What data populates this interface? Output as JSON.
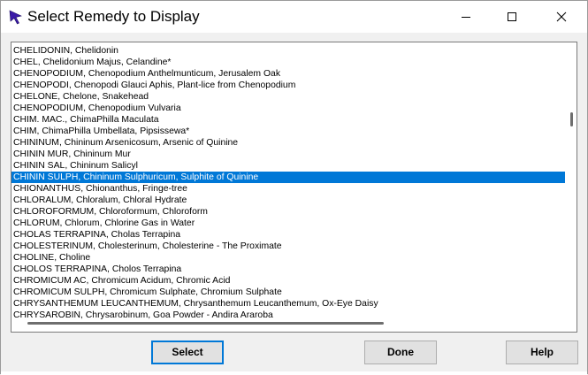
{
  "window": {
    "title": "Select Remedy to Display"
  },
  "titlebar_buttons": {
    "minimize_icon": "minimize-icon",
    "maximize_icon": "maximize-icon",
    "close_icon": "close-icon"
  },
  "list": {
    "items": [
      "CHELIDONIN, Chelidonin",
      "CHEL, Chelidonium Majus, Celandine*",
      "CHENOPODIUM, Chenopodium Anthelmunticum, Jerusalem Oak",
      "CHENOPODI, Chenopodi Glauci Aphis, Plant-lice from Chenopodium",
      "CHELONE, Chelone, Snakehead",
      "CHENOPODIUM, Chenopodium Vulvaria",
      "CHIM. MAC., ChimaPhilla Maculata",
      "CHIM, ChimaPhilla Umbellata, Pipsissewa*",
      "CHININUM, Chininum Arsenicosum, Arsenic of Quinine",
      "CHININ MUR, Chininum Mur",
      "CHININ SAL, Chininum Salicyl",
      "CHININ SULPH, Chininum Sulphuricum, Sulphite of Quinine",
      "CHIONANTHUS, Chionanthus, Fringe-tree",
      "CHLORALUM, Chloralum, Chloral Hydrate",
      "CHLOROFORMUM, Chloroformum, Chloroform",
      "CHLORUM, Chlorum, Chlorine Gas in Water",
      "CHOLAS TERRAPINA, Cholas Terrapina",
      "CHOLESTERINUM, Cholesterinum, Cholesterine - The Proximate",
      "CHOLINE, Choline",
      "CHOLOS TERRAPINA, Cholos Terrapina",
      "CHROMICUM AC, Chromicum Acidum, Chromic Acid",
      "CHROMICUM SULPH, Chromicum Sulphate, Chromium Sulphate",
      "CHRYSANTHEMUM LEUCANTHEMUM, Chrysanthemum Leucanthemum, Ox-Eye Daisy",
      "CHRYSAROBIN, Chrysarobinum, Goa Powder - Andira Araroba"
    ],
    "selected_index": 11
  },
  "buttons": {
    "select_label": "Select",
    "done_label": "Done",
    "help_label": "Help"
  },
  "colors": {
    "selection": "#0078d7",
    "window_bg": "#f0f0f0",
    "button_bg": "#e1e1e1",
    "default_button_border": "#0078d7"
  }
}
